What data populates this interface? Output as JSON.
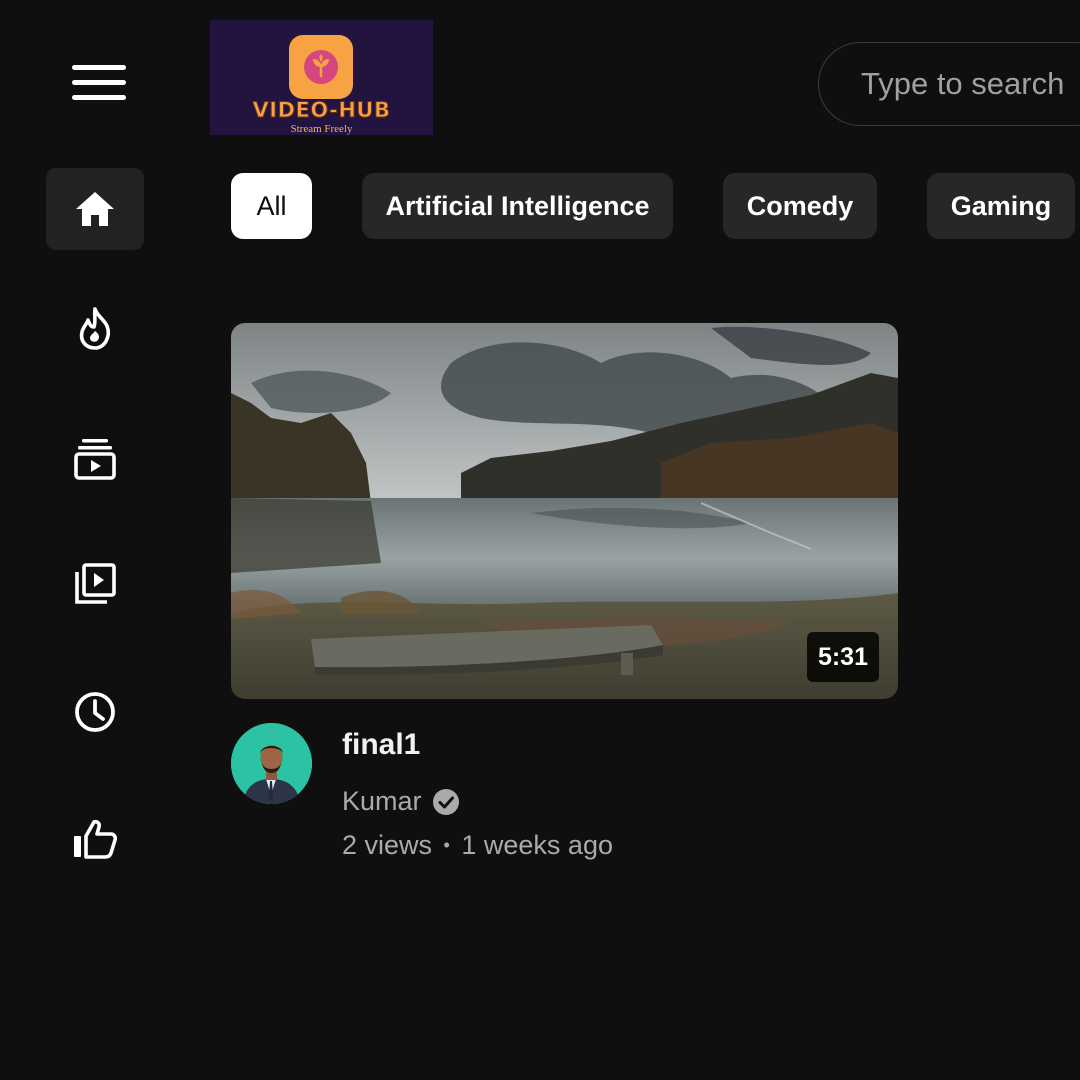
{
  "header": {
    "menu_icon": "hamburger-menu-icon",
    "logo": {
      "brand": "VIDEO-HUB",
      "tagline": "Stream Freely",
      "icon": "sprout-app-icon",
      "colors": {
        "background": "#23143f",
        "accent": "#f7a343",
        "icon_dot": "#d64680"
      }
    },
    "search": {
      "placeholder": "Type to search",
      "value": ""
    }
  },
  "sidebar": {
    "items": [
      {
        "icon": "home-icon",
        "active": true
      },
      {
        "icon": "trending-fire-icon",
        "active": false
      },
      {
        "icon": "subscriptions-icon",
        "active": false
      },
      {
        "icon": "library-icon",
        "active": false
      },
      {
        "icon": "history-clock-icon",
        "active": false
      },
      {
        "icon": "liked-thumbs-up-icon",
        "active": false
      }
    ]
  },
  "categories": {
    "chips": [
      {
        "label": "All",
        "active": true
      },
      {
        "label": "Artificial Intelligence",
        "active": false
      },
      {
        "label": "Comedy",
        "active": false
      },
      {
        "label": "Gaming",
        "active": false
      }
    ]
  },
  "videos": [
    {
      "title": "final1",
      "channel": "Kumar",
      "verified": true,
      "views": "2 views",
      "separator": "•",
      "age": "1 weeks ago",
      "duration": "5:31",
      "thumbnail": "lake-landscape-thumbnail"
    }
  ],
  "theme": {
    "background": "#0f0f0f",
    "chip": "#272727",
    "chip_active": "#ffffff",
    "secondary_text": "#aaaaaa"
  }
}
